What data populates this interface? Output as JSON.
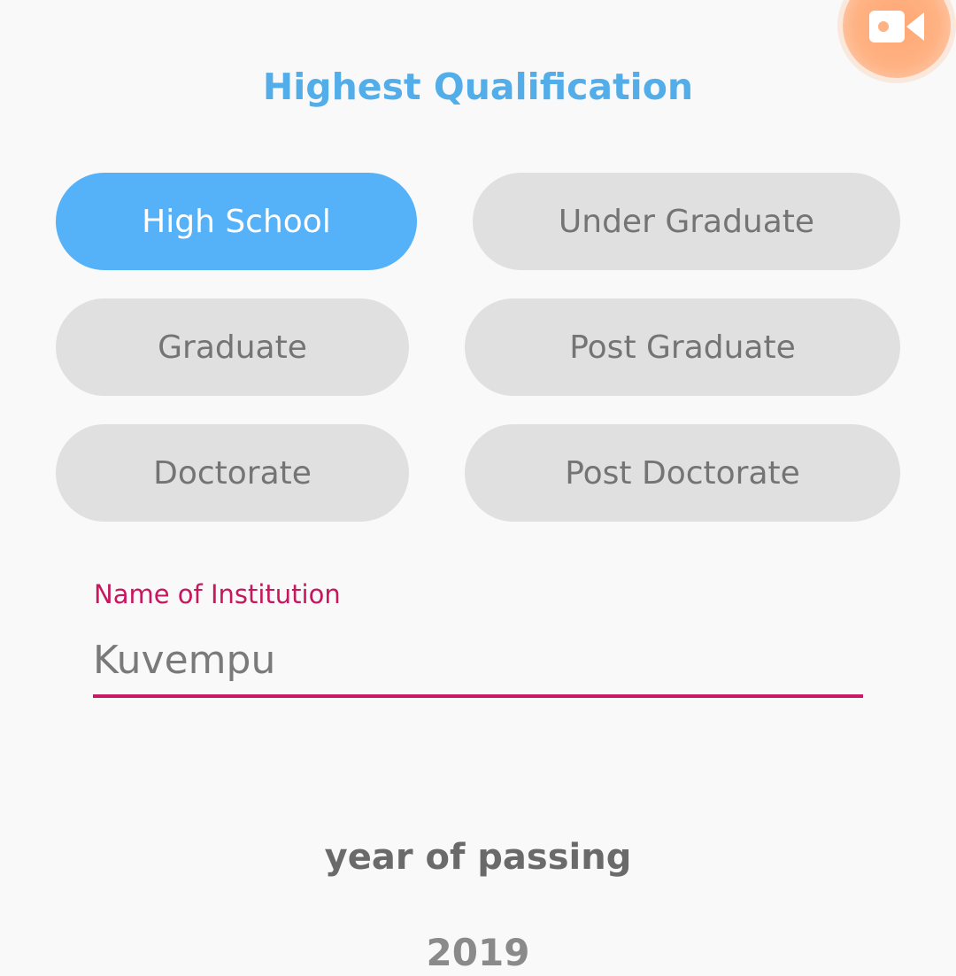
{
  "header": {
    "title": "Highest Qualification"
  },
  "qualification_options": [
    {
      "label": "High School",
      "selected": true
    },
    {
      "label": "Under Graduate",
      "selected": false
    },
    {
      "label": "Graduate",
      "selected": false
    },
    {
      "label": "Post Graduate",
      "selected": false
    },
    {
      "label": "Doctorate",
      "selected": false
    },
    {
      "label": "Post Doctorate",
      "selected": false
    }
  ],
  "institution": {
    "label": "Name of Institution",
    "value": "Kuvempu"
  },
  "year_of_passing": {
    "heading": "year of passing",
    "value": "2019"
  },
  "record_button": {
    "icon": "video-camera-icon"
  },
  "colors": {
    "accent": "#55b1f8",
    "title": "#52ade9",
    "field_accent": "#c91b63",
    "chip_inactive": "#e0e0e0",
    "record_button": "#ffa673"
  }
}
